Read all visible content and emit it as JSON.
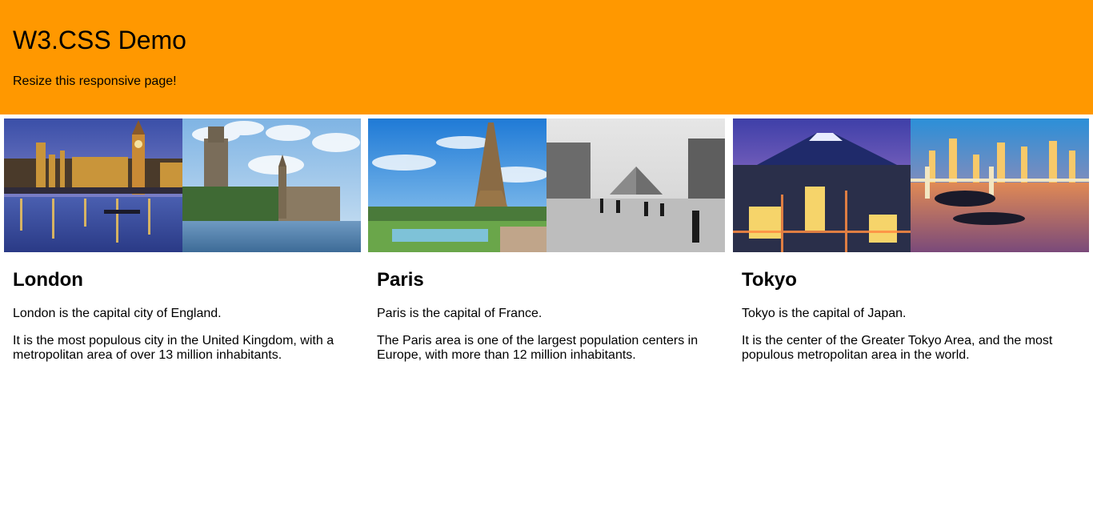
{
  "header": {
    "title": "W3.CSS Demo",
    "subtitle": "Resize this responsive page!",
    "background": "#ff9800"
  },
  "cities": [
    {
      "name": "London",
      "p1": "London is the capital city of England.",
      "p2": "It is the most populous city in the United Kingdom, with a metropolitan area of over 13 million inhabitants."
    },
    {
      "name": "Paris",
      "p1": "Paris is the capital of France.",
      "p2": "The Paris area is one of the largest population centers in Europe, with more than 12 million inhabitants."
    },
    {
      "name": "Tokyo",
      "p1": "Tokyo is the capital of Japan.",
      "p2": "It is the center of the Greater Tokyo Area, and the most populous metropolitan area in the world."
    }
  ]
}
